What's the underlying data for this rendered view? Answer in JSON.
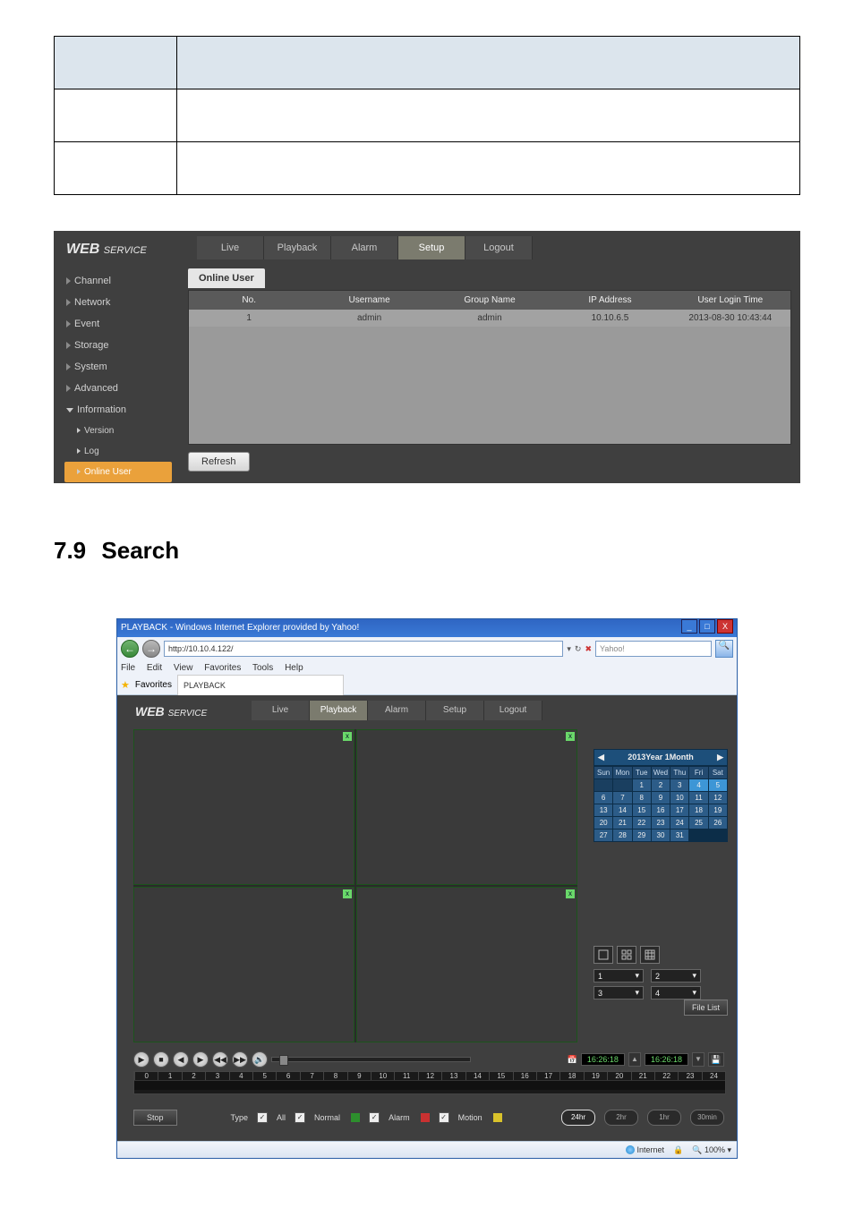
{
  "info_table": {
    "cells": [
      [
        "",
        ""
      ],
      [
        "",
        ""
      ],
      [
        "",
        ""
      ]
    ]
  },
  "heading": {
    "number": "7.9",
    "title": "Search"
  },
  "webservice": {
    "brand": "WEB",
    "brand_sub": "SERVICE",
    "nav": [
      "Live",
      "Playback",
      "Alarm",
      "Setup",
      "Logout"
    ],
    "nav_active": "Setup",
    "sidebar": [
      {
        "label": "Channel",
        "type": "top"
      },
      {
        "label": "Network",
        "type": "top"
      },
      {
        "label": "Event",
        "type": "top"
      },
      {
        "label": "Storage",
        "type": "top"
      },
      {
        "label": "System",
        "type": "top"
      },
      {
        "label": "Advanced",
        "type": "top"
      },
      {
        "label": "Information",
        "type": "top",
        "expanded": true
      },
      {
        "label": "Version",
        "type": "sub"
      },
      {
        "label": "Log",
        "type": "sub"
      },
      {
        "label": "Online User",
        "type": "sub",
        "active": true
      }
    ],
    "content_tab": "Online User",
    "grid": {
      "columns": [
        "No.",
        "Username",
        "Group Name",
        "IP Address",
        "User Login Time"
      ],
      "rows": [
        {
          "no": "1",
          "username": "admin",
          "group": "admin",
          "ip": "10.10.6.5",
          "time": "2013-08-30 10:43:44"
        }
      ]
    },
    "refresh": "Refresh"
  },
  "browser": {
    "title": "PLAYBACK - Windows Internet Explorer provided by Yahoo!",
    "url": "http://10.10.4.122/",
    "search_placeholder": "Yahoo!",
    "menu": [
      "File",
      "Edit",
      "View",
      "Favorites",
      "Tools",
      "Help"
    ],
    "fav_label": "Favorites",
    "fav_tab": "PLAYBACK",
    "status_zone": "Internet",
    "status_zoom": "100%"
  },
  "playback": {
    "brand": "WEB",
    "brand_sub": "SERVICE",
    "nav": [
      "Live",
      "Playback",
      "Alarm",
      "Setup",
      "Logout"
    ],
    "nav_active": "Playback",
    "calendar": {
      "header": "2013Year 1Month",
      "dow": [
        "Sun",
        "Mon",
        "Tue",
        "Wed",
        "Thu",
        "Fri",
        "Sat"
      ],
      "leading_blanks": 2,
      "days": 31,
      "selected": [
        4,
        5
      ]
    },
    "channel_selects": [
      "1",
      "2",
      "3",
      "4"
    ],
    "file_list": "File List",
    "time_current": "16:26:18",
    "time_goto": "16:26:18",
    "timeline_hours": [
      "0",
      "1",
      "2",
      "3",
      "4",
      "5",
      "6",
      "7",
      "8",
      "9",
      "10",
      "11",
      "12",
      "13",
      "14",
      "15",
      "16",
      "17",
      "18",
      "19",
      "20",
      "21",
      "22",
      "23",
      "24"
    ],
    "stop": "Stop",
    "type_label": "Type",
    "legend": [
      {
        "name": "All",
        "checked": true
      },
      {
        "name": "Normal",
        "checked": true,
        "swatch": "sw-green"
      },
      {
        "name": "Alarm",
        "checked": true,
        "swatch": "sw-red"
      },
      {
        "name": "Motion",
        "checked": true,
        "swatch": "sw-yellow"
      }
    ],
    "zoom": [
      "24hr",
      "2hr",
      "1hr",
      "30min"
    ]
  }
}
